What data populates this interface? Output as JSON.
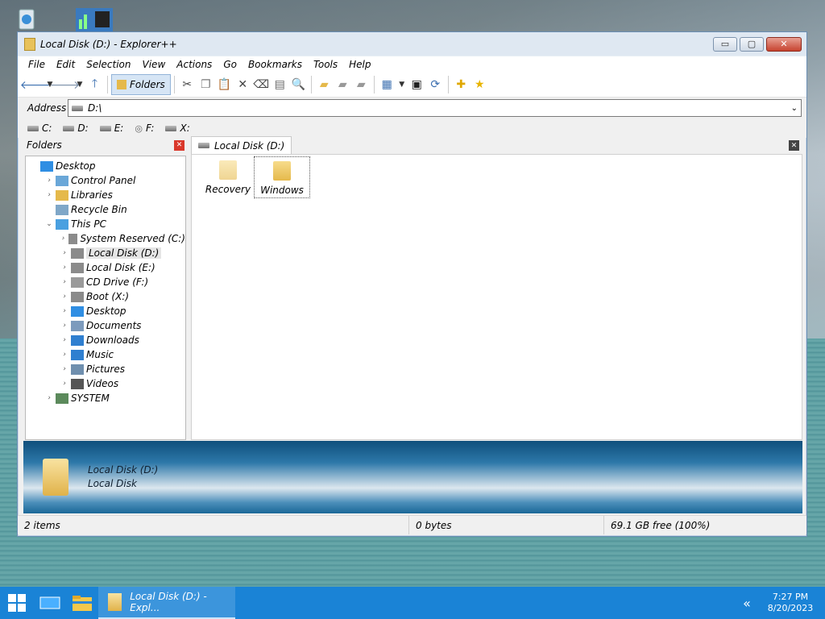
{
  "window": {
    "title": "Local Disk (D:) - Explorer++",
    "buttons": {
      "minimize": "▭",
      "maximize": "▢",
      "close": "✕"
    }
  },
  "menu": [
    "File",
    "Edit",
    "Selection",
    "View",
    "Actions",
    "Go",
    "Bookmarks",
    "Tools",
    "Help"
  ],
  "toolbar": {
    "folders_label": "Folders",
    "icons": [
      "back-icon",
      "back-dropdown-icon",
      "forward-icon",
      "forward-dropdown-icon",
      "up-icon",
      "folders-icon",
      "cut-icon",
      "copy-icon",
      "paste-icon",
      "delete-icon",
      "delete-permanently-icon",
      "properties-icon",
      "search-icon",
      "new-folder-icon",
      "copy-to-icon",
      "move-to-icon",
      "views-icon",
      "views-dropdown-icon",
      "command-prompt-icon",
      "refresh-icon",
      "bookmark-add-icon",
      "bookmarks-icon"
    ]
  },
  "address": {
    "label": "Address",
    "value": "D:\\"
  },
  "drives": [
    "C:",
    "D:",
    "E:",
    "F:",
    "X:"
  ],
  "folders_pane": {
    "title": "Folders",
    "tree": [
      {
        "label": "Desktop",
        "level": 0,
        "expander": "",
        "icon": "desktop-icon"
      },
      {
        "label": "Control Panel",
        "level": 1,
        "expander": "›",
        "icon": "control-panel-icon"
      },
      {
        "label": "Libraries",
        "level": 1,
        "expander": "›",
        "icon": "libraries-icon"
      },
      {
        "label": "Recycle Bin",
        "level": 1,
        "expander": "",
        "icon": "recycle-bin-icon"
      },
      {
        "label": "This PC",
        "level": 1,
        "expander": "⌄",
        "icon": "this-pc-icon"
      },
      {
        "label": "System Reserved (C:)",
        "level": 2,
        "expander": "›",
        "icon": "drive-icon"
      },
      {
        "label": "Local Disk (D:)",
        "level": 2,
        "expander": "›",
        "icon": "drive-icon",
        "selected": true
      },
      {
        "label": "Local Disk (E:)",
        "level": 2,
        "expander": "›",
        "icon": "drive-icon"
      },
      {
        "label": "CD Drive (F:)",
        "level": 2,
        "expander": "›",
        "icon": "cd-drive-icon"
      },
      {
        "label": "Boot (X:)",
        "level": 2,
        "expander": "›",
        "icon": "drive-icon"
      },
      {
        "label": "Desktop",
        "level": 2,
        "expander": "›",
        "icon": "desktop-icon"
      },
      {
        "label": "Documents",
        "level": 2,
        "expander": "›",
        "icon": "documents-icon"
      },
      {
        "label": "Downloads",
        "level": 2,
        "expander": "›",
        "icon": "downloads-icon"
      },
      {
        "label": "Music",
        "level": 2,
        "expander": "›",
        "icon": "music-icon"
      },
      {
        "label": "Pictures",
        "level": 2,
        "expander": "›",
        "icon": "pictures-icon"
      },
      {
        "label": "Videos",
        "level": 2,
        "expander": "›",
        "icon": "videos-icon"
      },
      {
        "label": "SYSTEM",
        "level": 1,
        "expander": "›",
        "icon": "user-icon"
      }
    ]
  },
  "tab": {
    "label": "Local Disk (D:)"
  },
  "files": [
    {
      "name": "Recovery",
      "icon": "folder-icon"
    },
    {
      "name": "Windows",
      "icon": "folder-icon",
      "selected": true
    }
  ],
  "info_pane": {
    "name": "Local Disk (D:)",
    "type": "Local Disk"
  },
  "status": {
    "items": "2 items",
    "size": "0 bytes",
    "free": "69.1 GB free (100%)"
  },
  "taskbar": {
    "app_label": "Local Disk (D:) - Expl...",
    "time": "7:27 PM",
    "date": "8/20/2023"
  },
  "colors": {
    "taskbar": "#1a83d6",
    "selection": "#d6e5f5",
    "close": "#c7432f"
  }
}
